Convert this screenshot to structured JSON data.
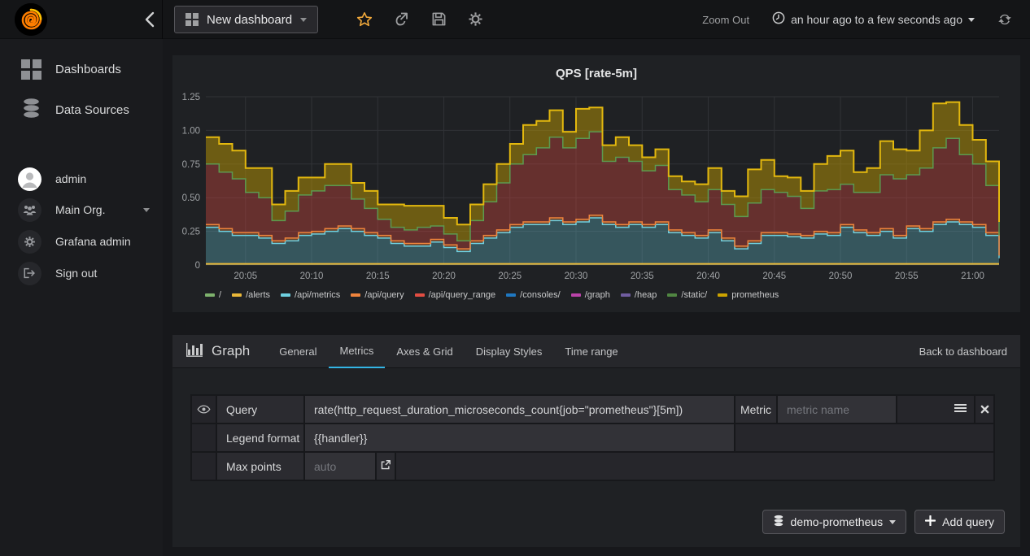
{
  "navbar": {
    "dashboard_title": "New dashboard",
    "zoom_out_label": "Zoom Out",
    "time_range_label": "an hour ago to a few seconds ago"
  },
  "sidebar": {
    "items": [
      {
        "label": "Dashboards"
      },
      {
        "label": "Data Sources"
      }
    ],
    "user": {
      "name": "admin",
      "org": "Main Org.",
      "admin_label": "Grafana admin",
      "signout_label": "Sign out"
    }
  },
  "graph_panel": {
    "title": "QPS [rate-5m]"
  },
  "editor": {
    "panel_type": "Graph",
    "tabs": [
      "General",
      "Metrics",
      "Axes & Grid",
      "Display Styles",
      "Time range"
    ],
    "active_tab": "Metrics",
    "back_link": "Back to dashboard",
    "query_row": {
      "label": "Query",
      "value": "rate(http_request_duration_microseconds_count{job=\"prometheus\"}[5m])",
      "metric_label": "Metric",
      "metric_placeholder": "metric name"
    },
    "legend_row": {
      "label": "Legend format",
      "value": "{{handler}}"
    },
    "max_points_row": {
      "label": "Max points",
      "placeholder": "auto"
    },
    "datasource_button": "demo-prometheus",
    "add_query_button": "Add query"
  },
  "colors": {
    "accent_blue": "#33B5E5",
    "star_orange": "#F2A93B",
    "grid": "#303236",
    "tick_text": "#9FA2A5"
  },
  "chart_data": {
    "type": "area",
    "stacked": true,
    "title": "QPS [rate-5m]",
    "ylim": [
      0,
      1.25
    ],
    "y_ticks": [
      "0",
      "0.25",
      "0.50",
      "0.75",
      "1.00",
      "1.25"
    ],
    "x_ticks": [
      "20:05",
      "20:10",
      "20:15",
      "20:20",
      "20:25",
      "20:30",
      "20:35",
      "20:40",
      "20:45",
      "20:50",
      "20:55",
      "21:00"
    ],
    "x_start": "20:02",
    "x_end": "21:02",
    "step_minutes": 1,
    "grid": true,
    "legend_position": "bottom",
    "legend": [
      {
        "label": "/",
        "color": "#7EB26D"
      },
      {
        "label": "/alerts",
        "color": "#EAB839"
      },
      {
        "label": "/api/metrics",
        "color": "#6ED0E0"
      },
      {
        "label": "/api/query",
        "color": "#EF843C"
      },
      {
        "label": "/api/query_range",
        "color": "#E24D42"
      },
      {
        "label": "/consoles/",
        "color": "#1F78C1"
      },
      {
        "label": "/graph",
        "color": "#BA43A9"
      },
      {
        "label": "/heap",
        "color": "#705DA0"
      },
      {
        "label": "/static/",
        "color": "#508642"
      },
      {
        "label": "prometheus",
        "color": "#CCA300"
      }
    ],
    "flat_series": [
      {
        "name": "/",
        "color": "#7EB26D",
        "value": 0.004
      },
      {
        "name": "/alerts",
        "color": "#EAB839",
        "value": 0.008
      },
      {
        "name": "/consoles/",
        "color": "#1F78C1",
        "value": 0.002
      },
      {
        "name": "/graph",
        "color": "#BA43A9",
        "value": 0.002
      },
      {
        "name": "/heap",
        "color": "#705DA0",
        "value": 0.002
      },
      {
        "name": "/static/",
        "color": "#508642",
        "value": 0.003
      }
    ],
    "series": [
      {
        "name": "/api/metrics",
        "color": "#6ED0E0",
        "edge_color": "#6ED0E0",
        "fill_opacity": 0.3,
        "values": [
          0.28,
          0.25,
          0.22,
          0.22,
          0.2,
          0.16,
          0.18,
          0.22,
          0.23,
          0.25,
          0.27,
          0.25,
          0.22,
          0.2,
          0.16,
          0.14,
          0.14,
          0.17,
          0.13,
          0.1,
          0.16,
          0.2,
          0.24,
          0.28,
          0.3,
          0.3,
          0.33,
          0.3,
          0.32,
          0.35,
          0.3,
          0.28,
          0.3,
          0.28,
          0.3,
          0.24,
          0.22,
          0.2,
          0.24,
          0.18,
          0.12,
          0.16,
          0.22,
          0.22,
          0.21,
          0.2,
          0.23,
          0.22,
          0.28,
          0.24,
          0.22,
          0.25,
          0.2,
          0.27,
          0.25,
          0.3,
          0.32,
          0.3,
          0.28,
          0.22,
          0.05
        ]
      },
      {
        "name": "/api/query",
        "color": "#EF843C",
        "edge_color": "#EF843C",
        "fill_opacity": 0.35,
        "values": [
          0.02,
          0.02,
          0.02,
          0.02,
          0.02,
          0.02,
          0.02,
          0.02,
          0.02,
          0.02,
          0.02,
          0.02,
          0.02,
          0.02,
          0.02,
          0.02,
          0.02,
          0.02,
          0.02,
          0.02,
          0.02,
          0.02,
          0.02,
          0.02,
          0.02,
          0.02,
          0.02,
          0.02,
          0.02,
          0.02,
          0.02,
          0.02,
          0.02,
          0.02,
          0.02,
          0.02,
          0.02,
          0.02,
          0.02,
          0.02,
          0.02,
          0.02,
          0.02,
          0.02,
          0.02,
          0.02,
          0.02,
          0.02,
          0.02,
          0.02,
          0.02,
          0.02,
          0.02,
          0.02,
          0.02,
          0.02,
          0.02,
          0.02,
          0.02,
          0.02,
          0.02
        ]
      },
      {
        "name": "/api/query_range",
        "color": "#E24D42",
        "edge_color": "#5C9A50",
        "fill_opacity": 0.37,
        "values": [
          0.45,
          0.42,
          0.4,
          0.3,
          0.28,
          0.15,
          0.2,
          0.28,
          0.3,
          0.32,
          0.3,
          0.22,
          0.18,
          0.12,
          0.1,
          0.1,
          0.12,
          0.1,
          0.08,
          0.06,
          0.15,
          0.25,
          0.35,
          0.45,
          0.5,
          0.55,
          0.6,
          0.55,
          0.6,
          0.62,
          0.45,
          0.5,
          0.45,
          0.4,
          0.42,
          0.3,
          0.28,
          0.25,
          0.3,
          0.25,
          0.22,
          0.28,
          0.32,
          0.3,
          0.28,
          0.2,
          0.3,
          0.32,
          0.3,
          0.28,
          0.3,
          0.4,
          0.42,
          0.38,
          0.45,
          0.55,
          0.6,
          0.5,
          0.45,
          0.35,
          0.15
        ]
      },
      {
        "name": "prometheus",
        "color": "#CCA300",
        "edge_color": "#E3B80E",
        "fill_opacity": 0.45,
        "values": [
          0.2,
          0.21,
          0.21,
          0.18,
          0.22,
          0.12,
          0.15,
          0.13,
          0.1,
          0.16,
          0.16,
          0.12,
          0.13,
          0.11,
          0.17,
          0.18,
          0.16,
          0.15,
          0.12,
          0.12,
          0.12,
          0.13,
          0.14,
          0.15,
          0.22,
          0.2,
          0.2,
          0.12,
          0.22,
          0.18,
          0.12,
          0.15,
          0.12,
          0.1,
          0.12,
          0.1,
          0.1,
          0.13,
          0.16,
          0.1,
          0.15,
          0.25,
          0.22,
          0.12,
          0.14,
          0.13,
          0.2,
          0.25,
          0.25,
          0.15,
          0.18,
          0.25,
          0.22,
          0.18,
          0.28,
          0.33,
          0.27,
          0.22,
          0.18,
          0.18,
          0.1
        ]
      }
    ]
  }
}
